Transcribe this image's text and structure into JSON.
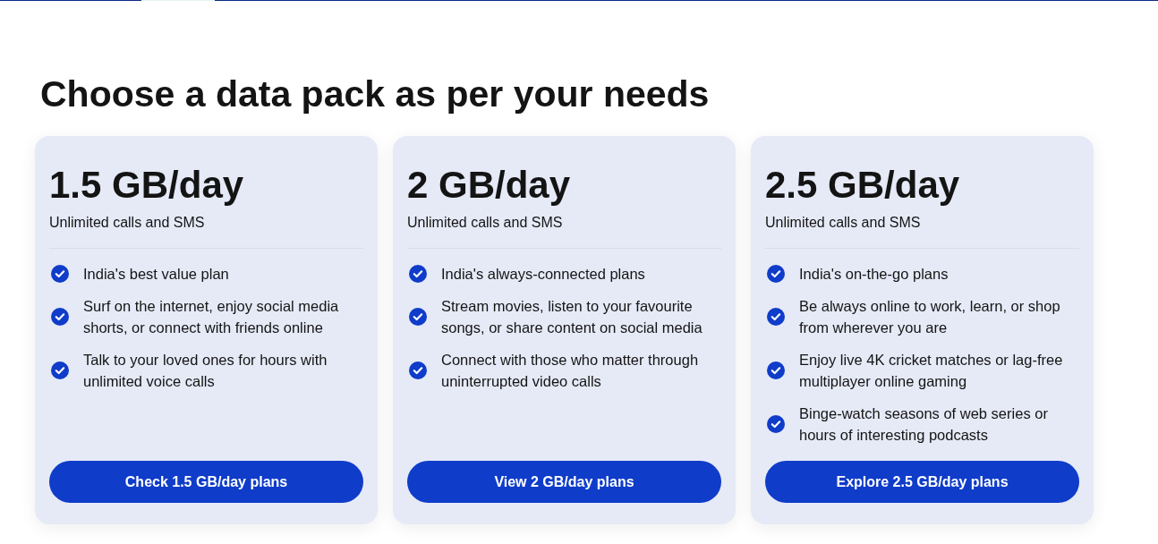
{
  "heading": "Choose a data pack as per your needs",
  "plans": [
    {
      "title": "1.5 GB/day",
      "subtitle": "Unlimited calls and SMS",
      "features": [
        "India's best value plan",
        "Surf on the internet, enjoy social media shorts, or connect with friends online",
        "Talk to your loved ones for hours with unlimited voice calls"
      ],
      "button": "Check 1.5 GB/day plans"
    },
    {
      "title": "2 GB/day",
      "subtitle": "Unlimited calls and SMS",
      "features": [
        "India's always-connected plans",
        "Stream movies, listen to your favourite songs, or share content on social media",
        "Connect with those who matter through uninterrupted video calls"
      ],
      "button": "View 2 GB/day plans"
    },
    {
      "title": "2.5 GB/day",
      "subtitle": "Unlimited calls and SMS",
      "features": [
        "India's on-the-go plans",
        "Be always online to work, learn, or shop from wherever you are",
        "Enjoy live 4K cricket matches or lag-free multiplayer online gaming",
        "Binge-watch seasons of web series or hours of interesting podcasts"
      ],
      "button": "Explore 2.5 GB/day plans"
    }
  ]
}
